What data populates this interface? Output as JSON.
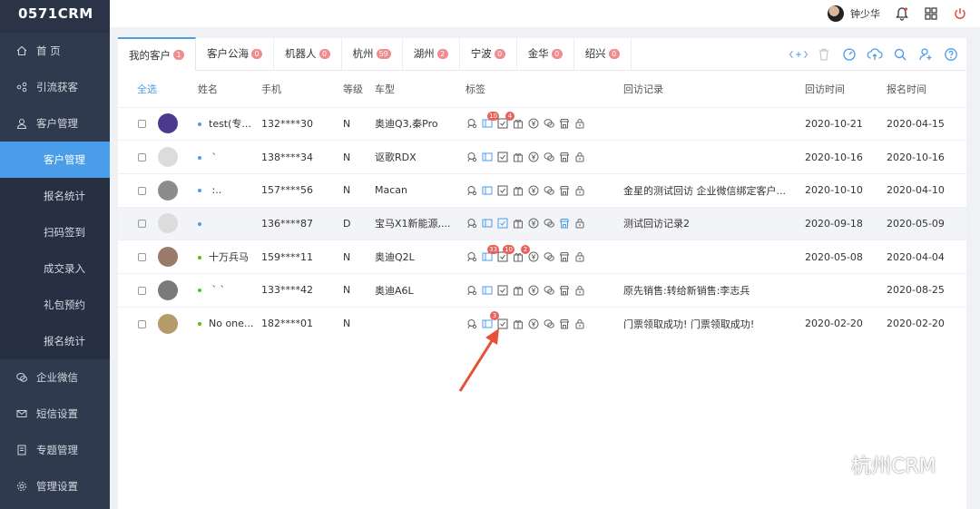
{
  "app": {
    "logo": "0571CRM"
  },
  "sidebar": {
    "items": [
      {
        "label": "首    页",
        "icon": "home-icon"
      },
      {
        "label": "引流获客",
        "icon": "share-icon"
      },
      {
        "label": "客户管理",
        "icon": "user-icon",
        "open": true,
        "children": [
          "客户管理",
          "报名统计",
          "扫码签到",
          "成交录入",
          "礼包预约",
          "报名统计"
        ]
      },
      {
        "label": "企业微信",
        "icon": "chat-icon"
      },
      {
        "label": "短信设置",
        "icon": "mail-icon"
      },
      {
        "label": "专题管理",
        "icon": "doc-icon"
      },
      {
        "label": "管理设置",
        "icon": "gear-icon"
      }
    ]
  },
  "topbar": {
    "username": "钟少华"
  },
  "tabs": [
    {
      "label": "我的客户",
      "count": "1"
    },
    {
      "label": "客户公海",
      "count": "0"
    },
    {
      "label": "机器人",
      "count": "0"
    },
    {
      "label": "杭州",
      "count": "59"
    },
    {
      "label": "湖州",
      "count": "2"
    },
    {
      "label": "宁波",
      "count": "0"
    },
    {
      "label": "金华",
      "count": "0"
    },
    {
      "label": "绍兴",
      "count": "0"
    }
  ],
  "table": {
    "headers": {
      "select_all": "全选",
      "name": "姓名",
      "phone": "手机",
      "level": "等级",
      "car": "车型",
      "tags": "标签",
      "record": "回访记录",
      "visit_time": "回访时间",
      "signup_time": "报名时间"
    },
    "rows": [
      {
        "name": "test(专...",
        "phone": "132****30",
        "level": "N",
        "car": "奥迪Q3,秦Pro",
        "record": "",
        "visit": "2020-10-21",
        "signup": "2020-04-15",
        "dot": "#4a9de8",
        "avatar": "#4b3b8f",
        "badges": {
          "1": "10",
          "2": "4"
        }
      },
      {
        "name": "     `",
        "phone": "138****34",
        "level": "N",
        "car": "讴歌RDX",
        "record": "",
        "visit": "2020-10-16",
        "signup": "2020-10-16",
        "dot": "#4a9de8",
        "avatar": "#dcdcdc",
        "badges": {}
      },
      {
        "name": "     :..",
        "phone": "157****56",
        "level": "N",
        "car": "Macan",
        "record": "金星的测试回访 企业微信绑定客户...",
        "visit": "2020-10-10",
        "signup": "2020-04-10",
        "dot": "#4a9de8",
        "avatar": "#8c8c8c",
        "badges": {}
      },
      {
        "name": "",
        "phone": "136****87",
        "level": "D",
        "car": "宝马X1新能源,...",
        "record": "测试回访记录2",
        "visit": "2020-09-18",
        "signup": "2020-05-09",
        "dot": "#4a9de8",
        "avatar": "#dcdcdc",
        "badges": {}
      },
      {
        "name": "十万兵马",
        "phone": "159****11",
        "level": "N",
        "car": "奥迪Q2L",
        "record": "",
        "visit": "2020-05-08",
        "signup": "2020-04-04",
        "dot": "#52c41a",
        "avatar": "#9a7b6a",
        "badges": {
          "1": "33",
          "2": "10",
          "3": "2"
        }
      },
      {
        "name": "  ` `",
        "phone": "133****42",
        "level": "N",
        "car": "奥迪A6L",
        "record": "原先销售:转给新销售:李志兵",
        "visit": "",
        "signup": "2020-08-25",
        "dot": "#52c41a",
        "avatar": "#7a7a7a",
        "badges": {}
      },
      {
        "name": "No one...",
        "phone": "182****01",
        "level": "N",
        "car": "",
        "record": "门票领取成功! 门票领取成功!",
        "visit": "2020-02-20",
        "signup": "2020-02-20",
        "dot": "#52c41a",
        "avatar": "#b59a6a",
        "badges": {
          "1": "3"
        }
      }
    ]
  },
  "watermark": "杭州CRM",
  "colors": {
    "accent": "#4a9de8",
    "sidebar": "#2f3a4e",
    "badge": "#e8615b",
    "arrow": "#e8503a"
  }
}
